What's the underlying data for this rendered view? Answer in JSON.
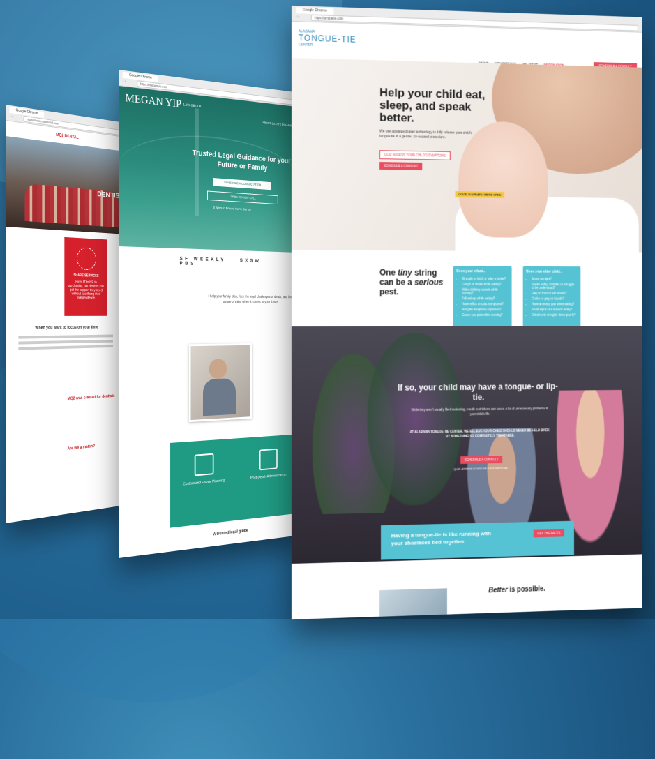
{
  "window1": {
    "tab": "Google Chrome",
    "url": "https://www.mqdental.com",
    "logo": "MQ2 DENTAL",
    "hero_word": "DENTIS",
    "card_title": "SHARE SERVICES",
    "card_text": "From IT to HR to purchasing, our dentists can get the support they need without sacrificing their independence.",
    "body_heading": "When you want to focus on your time",
    "section2": "MQ2 was created for dentists",
    "match": "Are we a match?"
  },
  "window2": {
    "tab": "Google Chrome",
    "url": "https://meganyip.com",
    "logo": "MEGAN YIP",
    "logo_sub": "LAW GROUP",
    "nav": "ABOUT   ESTATE PLANNING",
    "title": "Trusted Legal Guidance for your Future or Family",
    "btn_schedule": "SCHEDULE A CONSULTATION",
    "btn_free": "FREE REVIEW CALL",
    "ways": "5 Ways to Ensure You're Set Up",
    "press": [
      "SF WEEKLY",
      "SXSW",
      "PBS"
    ],
    "intro": "I help your family plan, face the legal challenges of death, and find peace of mind when it comes to your future.",
    "services": [
      "Customized Estate Planning",
      "Post-Death Administration"
    ],
    "footer": "A trusted legal guide"
  },
  "window3": {
    "tab": "Google Chrome",
    "url": "https://tonguetie.com",
    "logo_top": "ALABAMA",
    "logo_main": "TONGUE-TIE",
    "logo_sub": "CENTER",
    "nav": [
      "ABOUT",
      "NEW PATIENTS",
      "WE TREAT",
      "INFORMATION"
    ],
    "nav_cta": "SCHEDULE A CONSULT",
    "headline": "Help your child eat, sleep, and speak better.",
    "subtext": "We use advanced laser technology to fully release your child's tongue-tie in a gentle, 10-second procedure.",
    "btn_assess": "QUIZ: ASSESS YOUR CHILD'S SYMPTOMS",
    "btn_schedule": "SCHEDULE A CONSULT",
    "covid": "COVID-19 UPDATE: WE'RE OPEN",
    "pest_pre": "One",
    "pest_em": "tiny",
    "pest_mid": "string can be a",
    "pest_em2": "serious",
    "pest_post": "pest.",
    "infant_title": "Does your infant...",
    "infant_items": [
      "Struggle to latch or take a bottle?",
      "Cough or choke while eating?",
      "Make clicking sounds while nursing?",
      "Fall asleep while eating?",
      "Have reflux or colic symptoms?",
      "Not gain weight as expected?",
      "Cause you pain while nursing?"
    ],
    "older_title": "Does your older child...",
    "older_items": [
      "Snore at night?",
      "Speak softly, mumble or struggle to be understood?",
      "Gag on food or eat slowly?",
      "Choke or gag on liquids?",
      "Have a messy gap when eating?",
      "Show signs of a speech delay?",
      "Grind teeth at night, sleep poorly?"
    ],
    "dark_title": "If so, your child may have a tongue- or lip-tie.",
    "dark_text": "While they aren't usually life-threatening, mouth restrictions can cause a lot of unnecessary problems in your child's life.",
    "dark_bold": "AT ALABAMA TONGUE-TIE CENTER, WE BELIEVE YOUR CHILD SHOULD NEVER BE HELD BACK BY SOMETHING SO COMPLETELY TREATABLE.",
    "dark_btn": "SCHEDULE A CONSULT",
    "dark_link": "QUIZ: ASSESS YOUR CHILD'S SYMPTOMS",
    "strip_text": "Having a tongue-tie is like running with your shoelaces tied together.",
    "strip_btn": "GET THE FACTS",
    "better_em": "Better",
    "better_rest": "is possible."
  }
}
